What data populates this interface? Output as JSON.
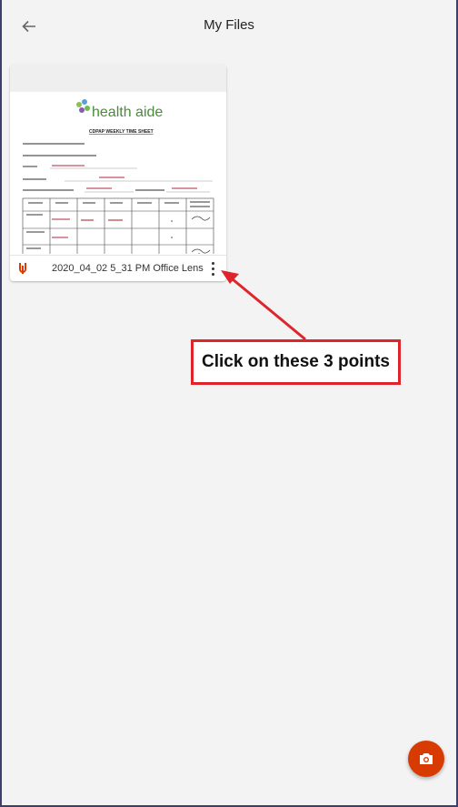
{
  "header": {
    "title": "My Files",
    "back_icon": "arrow-left-icon"
  },
  "files": [
    {
      "name": "2020_04_02 5_31 PM Office Lens",
      "icon": "office-lens-icon",
      "thumbnail": {
        "logo_text": "health aide",
        "doc_title": "CDPAP WEEKLY TIME SHEET"
      }
    }
  ],
  "annotation": {
    "text": "Click on these 3 points",
    "color": "#e0242b"
  },
  "fab": {
    "icon": "camera-icon",
    "color": "#d83b01"
  }
}
